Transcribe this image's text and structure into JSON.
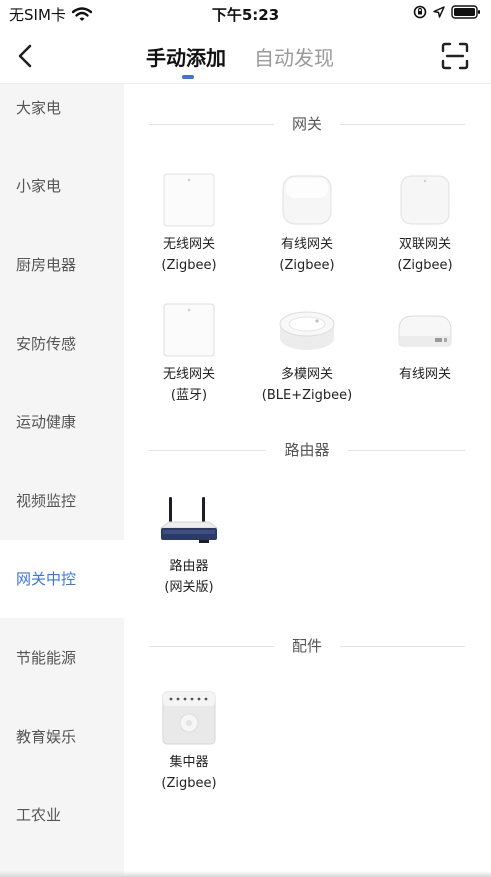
{
  "status_bar": {
    "carrier": "无SIM卡",
    "time": "下午5:23"
  },
  "nav": {
    "tabs": [
      {
        "label": "手动添加",
        "active": true
      },
      {
        "label": "自动发现",
        "active": false
      }
    ]
  },
  "sidebar": {
    "items": [
      {
        "label": "大家电"
      },
      {
        "label": "小家电"
      },
      {
        "label": "厨房电器"
      },
      {
        "label": "安防传感"
      },
      {
        "label": "运动健康"
      },
      {
        "label": "视频监控"
      },
      {
        "label": "网关中控",
        "active": true
      },
      {
        "label": "节能能源"
      },
      {
        "label": "教育娱乐"
      },
      {
        "label": "工农业"
      }
    ]
  },
  "sections": [
    {
      "title": "网关",
      "devices": [
        {
          "line1": "无线网关",
          "line2": "(Zigbee)",
          "icon": "square-gateway-icon"
        },
        {
          "line1": "有线网关",
          "line2": "(Zigbee)",
          "icon": "rounded-gateway-icon"
        },
        {
          "line1": "双联网关",
          "line2": "(Zigbee)",
          "icon": "rounded-gateway-icon"
        },
        {
          "line1": "无线网关",
          "line2": "(蓝牙)",
          "icon": "square-gateway-icon"
        },
        {
          "line1": "多模网关",
          "line2": "(BLE+Zigbee)",
          "icon": "round-hub-icon"
        },
        {
          "line1": "有线网关",
          "line2": "",
          "icon": "flat-gateway-icon"
        }
      ]
    },
    {
      "title": "路由器",
      "devices": [
        {
          "line1": "路由器",
          "line2": "(网关版)",
          "icon": "router-icon"
        }
      ]
    },
    {
      "title": "配件",
      "devices": [
        {
          "line1": "集中器",
          "line2": "(Zigbee)",
          "icon": "concentrator-icon"
        }
      ]
    }
  ],
  "colors": {
    "accent": "#3d73e6",
    "sidebar_bg": "#f5f5f5"
  }
}
